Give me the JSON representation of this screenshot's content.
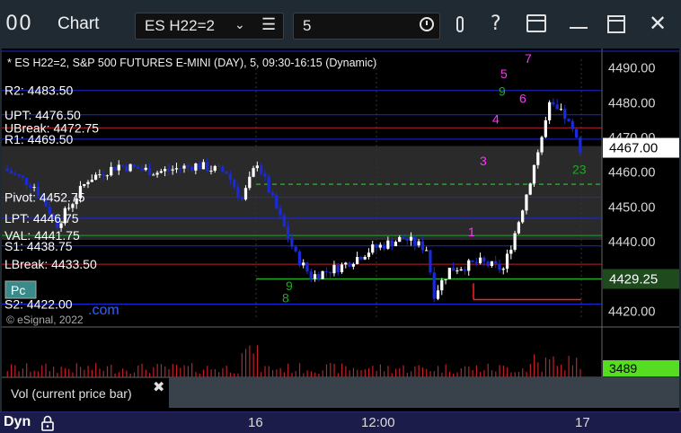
{
  "window": {
    "icon_glyph": "00",
    "title": "Chart",
    "symbol": "ES H22=2",
    "interval": "5",
    "icons": [
      "link-icon",
      "help-icon",
      "layout-icon",
      "minimize-icon",
      "maximize-icon",
      "close-icon"
    ],
    "help_glyph": "?",
    "close_glyph": "✕",
    "chevron_glyph": "⌄",
    "menu_glyph": "☰"
  },
  "header_text": "* ES H22=2, S&P 500 FUTURES E-MINI (DAY), 5, 09:30-16:15 (Dynamic)",
  "copyright": "© eSignal, 2022",
  "pc_badge": "Pc",
  "dotcom_fragment": ".com",
  "level_labels": [
    {
      "label": "R2: 4483.50",
      "price": 4483.5,
      "color": "#1a2ad8"
    },
    {
      "label": "UPT: 4476.50",
      "price": 4476.5,
      "color": "#1a2ad8"
    },
    {
      "label": "UBreak: 4472.75",
      "price": 4472.75,
      "color": "#c0202a"
    },
    {
      "label": "R1: 4469.50",
      "price": 4469.5,
      "color": "#1a2ad8"
    },
    {
      "label": "Pivot: 4452.75",
      "price": 4452.75,
      "color": "#1a2ad8"
    },
    {
      "label": "LPT: 4446.75",
      "price": 4446.75,
      "color": "#1a2ad8"
    },
    {
      "label": "VAL: 4441.75",
      "price": 4441.75,
      "color": "#20a030"
    },
    {
      "label": "S1: 4438.75",
      "price": 4438.75,
      "color": "#1a2ad8"
    },
    {
      "label": "LBreak: 4433.50",
      "price": 4433.5,
      "color": "#c0202a"
    },
    {
      "label": "S2: 4422.00",
      "price": 4422.0,
      "color": "#1a2ad8"
    }
  ],
  "price_axis": {
    "ticks": [
      "4490.00",
      "4480.00",
      "4470.00",
      "4460.00",
      "4450.00",
      "4440.00",
      "4430.00",
      "4420.00"
    ],
    "tick_values": [
      4490,
      4480,
      4470,
      4460,
      4450,
      4440,
      4430,
      4420
    ],
    "current_price": "4467.00",
    "current_price_value": 4467.0,
    "green_tag": "4429.25",
    "green_tag_value": 4429.25,
    "volume_tag": "3489"
  },
  "time_axis": [
    "16",
    "12:00",
    "17"
  ],
  "seq_labels": [
    {
      "text": "1",
      "price": 4441.5,
      "color": "#ff33ff"
    },
    {
      "text": "3",
      "price": 4462,
      "color": "#ff33ff"
    },
    {
      "text": "4",
      "price": 4474,
      "color": "#ff33ff"
    },
    {
      "text": "5",
      "price": 4487,
      "color": "#ff33ff"
    },
    {
      "text": "6",
      "price": 4480,
      "color": "#ff33ff"
    },
    {
      "text": "7",
      "price": 4491.5,
      "color": "#ff33ff"
    },
    {
      "text": "9",
      "price": 4482,
      "color": "#22aa22"
    },
    {
      "text": "23",
      "price": 4459.5,
      "color": "#22aa22"
    },
    {
      "text": "9",
      "price": 4426,
      "color": "#22aa22"
    },
    {
      "text": "8",
      "price": 4422.5,
      "color": "#22aa22"
    }
  ],
  "volume_panel": {
    "label": "Vol (current price bar)",
    "close_glyph": "✖"
  },
  "bottom_bar": {
    "label": "Dyn"
  },
  "colors": {
    "up_candle": "#ffffff",
    "down_candle": "#1a2ad8",
    "volume_bar": "#c0202a",
    "volume_tag": "#55dd22"
  }
}
